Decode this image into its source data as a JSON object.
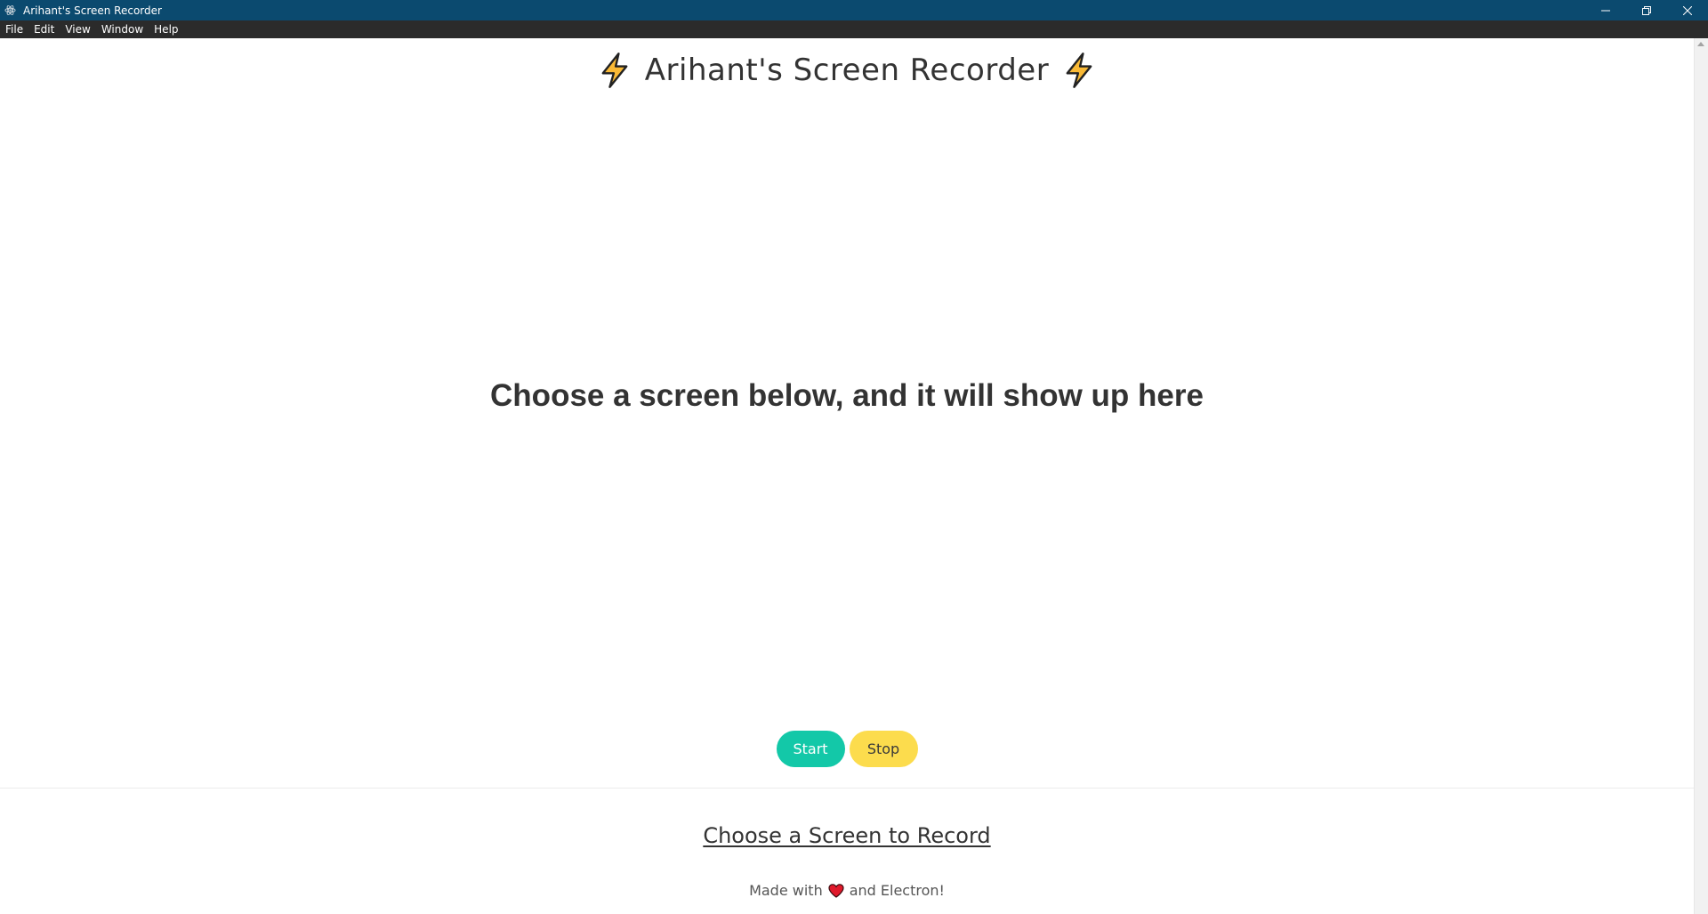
{
  "window": {
    "title": "Arihant's Screen Recorder",
    "icon": "electron-icon",
    "controls": {
      "minimize": "minimize-icon",
      "restore": "restore-icon",
      "close": "close-icon"
    },
    "titlebar_color": "#0b4a6f"
  },
  "menu": {
    "items": [
      {
        "label": "File"
      },
      {
        "label": "Edit"
      },
      {
        "label": "View"
      },
      {
        "label": "Window"
      },
      {
        "label": "Help"
      }
    ]
  },
  "header": {
    "title": "Arihant's Screen Recorder",
    "decoration_icon": "lightning-bolt-icon"
  },
  "preview": {
    "placeholder": "Choose a screen below, and it will show up here"
  },
  "controls": {
    "start_label": "Start",
    "stop_label": "Stop",
    "start_color": "#13c8a8",
    "stop_color": "#fcdc4d"
  },
  "source": {
    "select_label": "Choose a Screen to Record"
  },
  "footer": {
    "prefix": "Made with",
    "icon": "heart-icon",
    "suffix": "and Electron!"
  }
}
